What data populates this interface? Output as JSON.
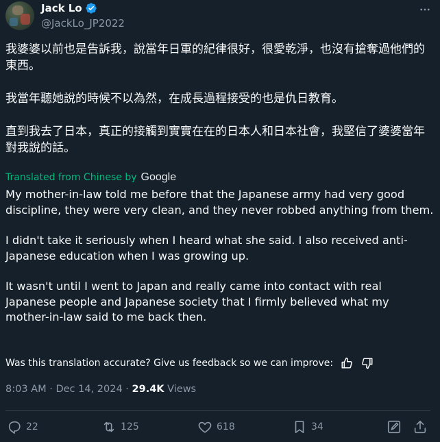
{
  "author": {
    "display_name": "Jack Lo",
    "handle": "@JackLo_JP2022",
    "verified": true
  },
  "tweet": {
    "original_paragraphs": [
      "我婆婆以前也是告訴我，說當年日軍的紀律很好，很愛乾淨，也沒有搶奪過他們的東西。",
      "我當年聽她說的時候不以為然，在成長過程接受的也是仇日教育。",
      "直到我去了日本，真正的接觸到實實在在的日本人和日本社會，我堅信了婆婆當年對我說的話。"
    ],
    "translated_from_label": "Translated from Chinese by",
    "translator_brand": "Google",
    "translation_paragraphs": [
      "My mother-in-law told me before that the Japanese army had very good discipline, they were very clean, and they never robbed anything from them.",
      "I didn't take it seriously when I heard what she said. I also received anti-Japanese education when I was growing up.",
      "It wasn't until I went to Japan and really came into contact with real Japanese people and Japanese society that I firmly believed what my mother-in-law said to me back then."
    ],
    "feedback_prompt": "Was this translation accurate? Give us feedback so we can improve:",
    "time": "8:03 AM",
    "separator": "·",
    "date": "Dec 14, 2024",
    "views_count": "29.4K",
    "views_label": "Views"
  },
  "actions": {
    "replies": "22",
    "reposts": "125",
    "likes": "618",
    "bookmarks": "34"
  },
  "colors": {
    "background": "#15202b",
    "text_primary": "#f7f9f9",
    "text_secondary": "#8b98a5",
    "translation_green": "#00ba7c",
    "verified_blue": "#1d9bf0",
    "divider": "#38444d"
  },
  "icons": {
    "verified": "verified-badge-icon",
    "more": "more-horizontal-icon",
    "thumbs_up": "thumbs-up-icon",
    "thumbs_down": "thumbs-down-icon",
    "reply": "reply-icon",
    "repost": "repost-icon",
    "like": "heart-icon",
    "bookmark": "bookmark-icon",
    "edit": "edit-icon",
    "share": "share-icon"
  }
}
